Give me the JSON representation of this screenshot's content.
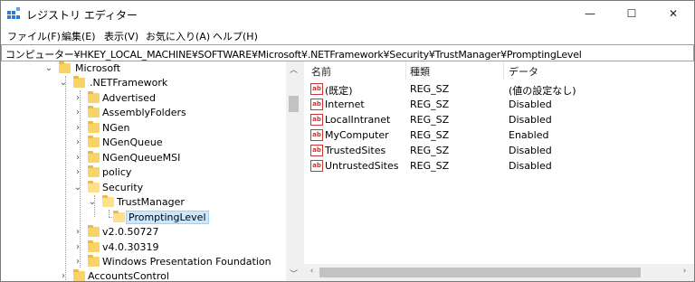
{
  "window": {
    "title": "レジストリ エディター"
  },
  "caption_buttons": {
    "minimize": "—",
    "maximize": "☐",
    "close": "✕"
  },
  "menu": [
    "ファイル(F)",
    "編集(E)",
    "表示(V)",
    "お気に入り(A)",
    "ヘルプ(H)"
  ],
  "address": "コンピューター¥HKEY_LOCAL_MACHINE¥SOFTWARE¥Microsoft¥.NETFramework¥Security¥TrustManager¥PromptingLevel",
  "tree": [
    {
      "label": "Microsoft",
      "expanded": true,
      "depth": 0
    },
    {
      "label": ".NETFramework",
      "expanded": true,
      "depth": 1
    },
    {
      "label": "Advertised",
      "expanded": false,
      "depth": 2
    },
    {
      "label": "AssemblyFolders",
      "expanded": false,
      "depth": 2
    },
    {
      "label": "NGen",
      "expanded": false,
      "depth": 2
    },
    {
      "label": "NGenQueue",
      "expanded": false,
      "depth": 2
    },
    {
      "label": "NGenQueueMSI",
      "expanded": false,
      "depth": 2
    },
    {
      "label": "policy",
      "expanded": false,
      "depth": 2
    },
    {
      "label": "Security",
      "expanded": true,
      "depth": 2
    },
    {
      "label": "TrustManager",
      "expanded": true,
      "depth": 3
    },
    {
      "label": "PromptingLevel",
      "selected": true,
      "depth": 4
    },
    {
      "label": "v2.0.50727",
      "expanded": false,
      "depth": 2
    },
    {
      "label": "v4.0.30319",
      "expanded": false,
      "depth": 2
    },
    {
      "label": "Windows Presentation Foundation",
      "expanded": false,
      "depth": 2
    },
    {
      "label": "AccountsControl",
      "expanded": false,
      "depth": 1
    }
  ],
  "list": {
    "columns": [
      "名前",
      "種類",
      "データ"
    ],
    "rows": [
      {
        "name": "(既定)",
        "type": "REG_SZ",
        "data": "(値の設定なし)"
      },
      {
        "name": "Internet",
        "type": "REG_SZ",
        "data": "Disabled"
      },
      {
        "name": "LocalIntranet",
        "type": "REG_SZ",
        "data": "Disabled"
      },
      {
        "name": "MyComputer",
        "type": "REG_SZ",
        "data": "Enabled"
      },
      {
        "name": "TrustedSites",
        "type": "REG_SZ",
        "data": "Disabled"
      },
      {
        "name": "UntrustedSites",
        "type": "REG_SZ",
        "data": "Disabled"
      }
    ],
    "value_icon_text": "ab"
  },
  "icons": {
    "app": "registry-editor-icon",
    "expanded": "chevron-down-icon",
    "collapsed": "chevron-right-icon",
    "folder": "folder-icon",
    "value": "string-value-icon"
  }
}
